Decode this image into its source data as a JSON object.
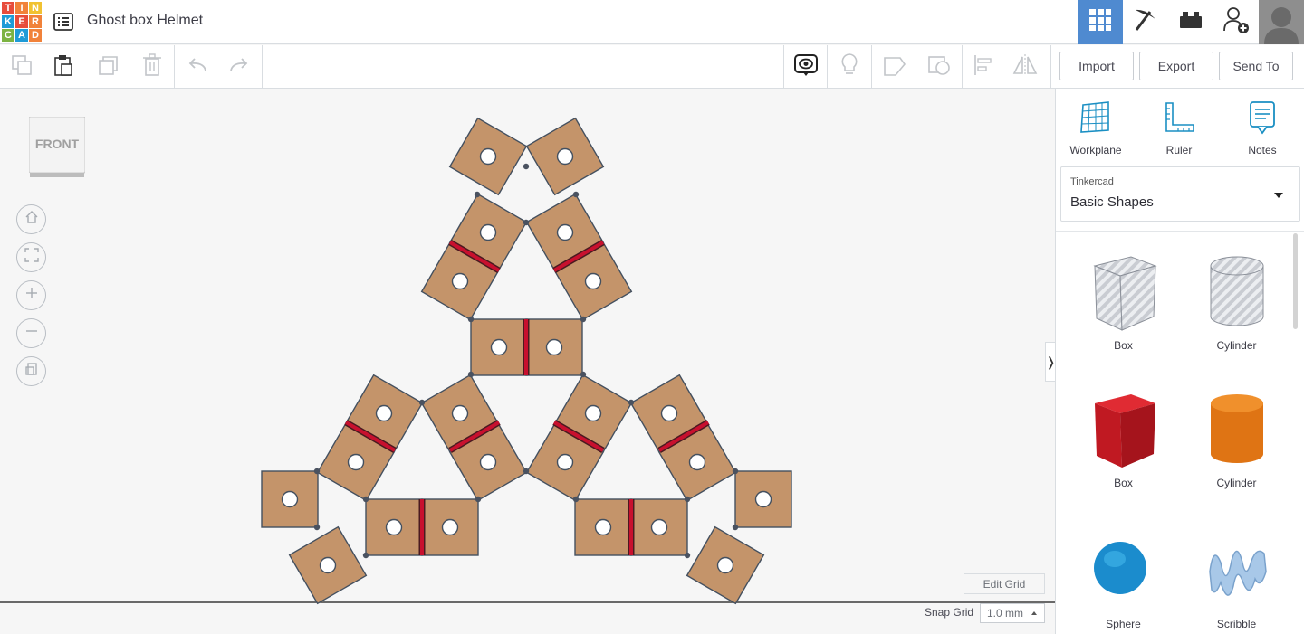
{
  "app": {
    "logo_letters": [
      "T",
      "I",
      "N",
      "K",
      "E",
      "R",
      "C",
      "A",
      "D"
    ],
    "logo_colors": [
      "#e74c3c",
      "#f1823a",
      "#f1c232",
      "#1e9bd7",
      "#e74c3c",
      "#f1823a",
      "#7cb342",
      "#1e9bd7",
      "#f1823a"
    ],
    "design_title": "Ghost box Helmet",
    "accent": "#4f8ad0"
  },
  "toolbar": {
    "import_label": "Import",
    "export_label": "Export",
    "send_to_label": "Send To"
  },
  "viewport": {
    "viewcube_label": "FRONT",
    "edit_grid_label": "Edit Grid",
    "snap_grid_label": "Snap Grid",
    "snap_grid_value": "1.0 mm",
    "panel_toggle_glyph": "❭",
    "part_color": "#c4946a",
    "hinge_color": "#c8102e"
  },
  "panel": {
    "tools": [
      {
        "label": "Workplane",
        "icon": "workplane-icon"
      },
      {
        "label": "Ruler",
        "icon": "ruler-icon"
      },
      {
        "label": "Notes",
        "icon": "notes-icon"
      }
    ],
    "library_source": "Tinkercad",
    "library_name": "Basic Shapes",
    "shapes": [
      {
        "label": "Box",
        "icon": "box-hole-icon"
      },
      {
        "label": "Cylinder",
        "icon": "cylinder-hole-icon"
      },
      {
        "label": "Box",
        "icon": "box-solid-icon"
      },
      {
        "label": "Cylinder",
        "icon": "cylinder-solid-icon"
      },
      {
        "label": "Sphere",
        "icon": "sphere-icon"
      },
      {
        "label": "Scribble",
        "icon": "scribble-icon"
      }
    ]
  }
}
